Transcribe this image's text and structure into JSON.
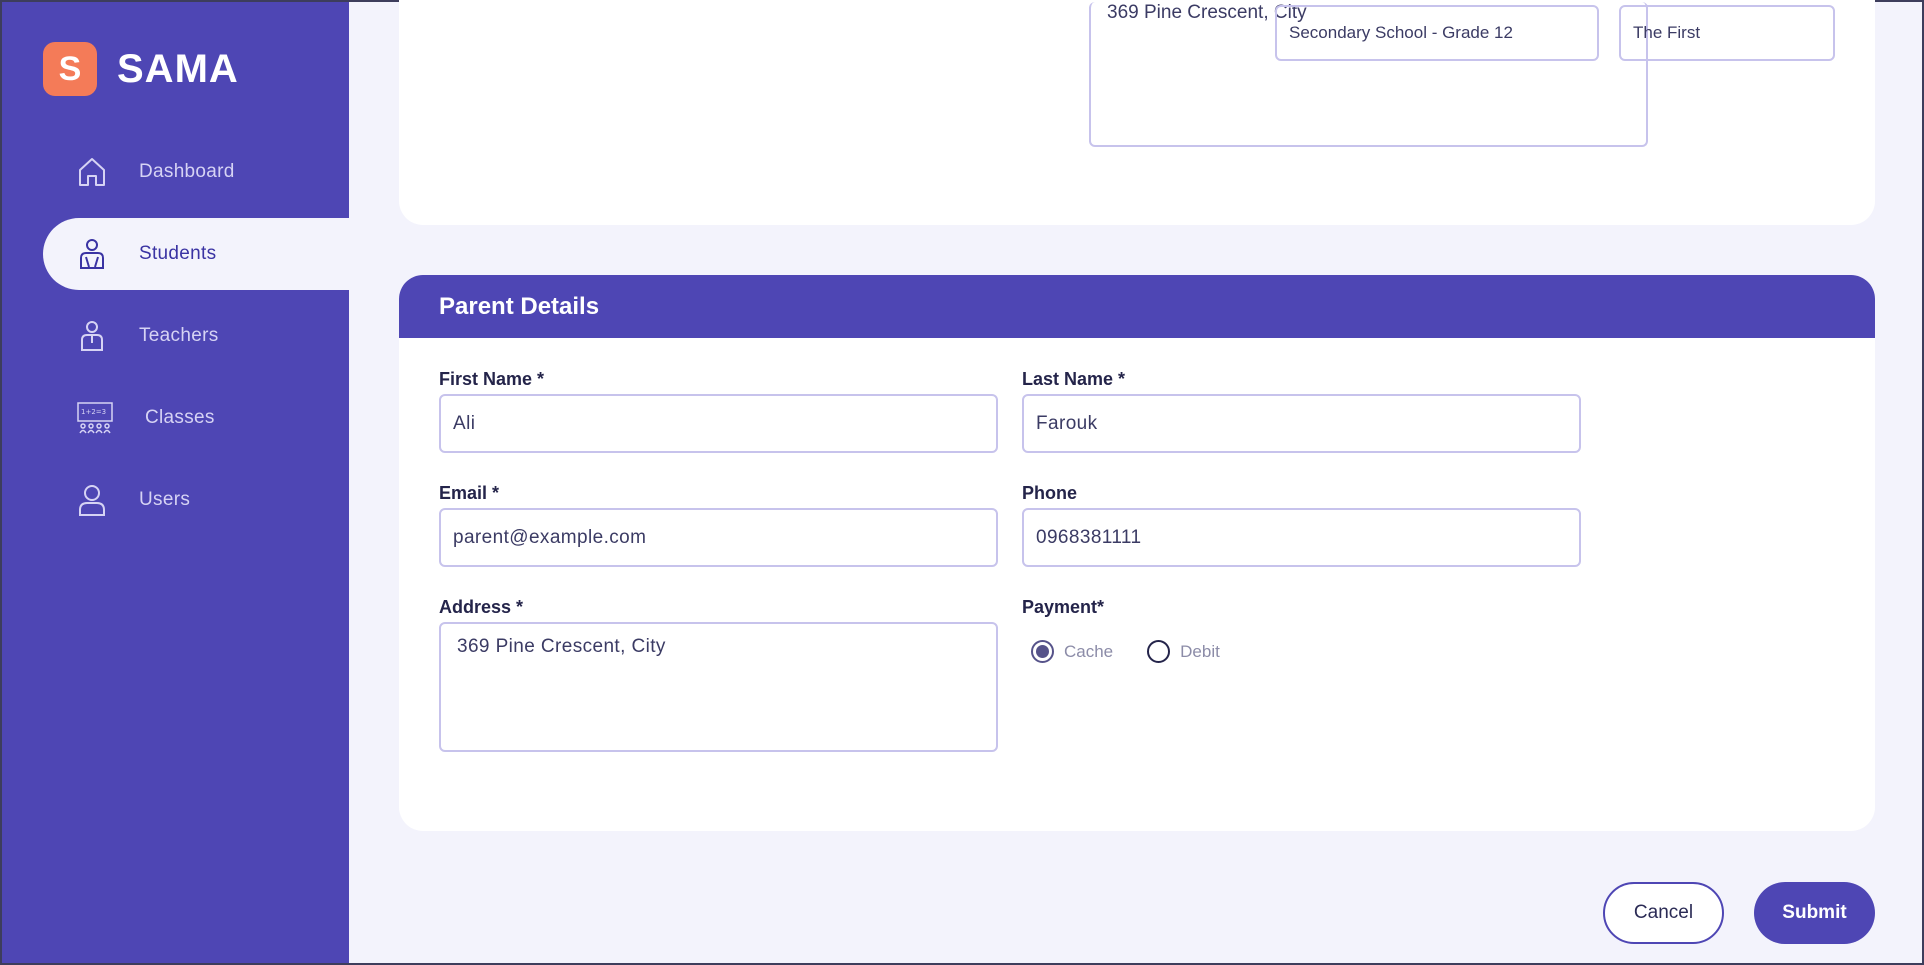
{
  "brand": {
    "logo_letter": "S",
    "name": "SAMA"
  },
  "sidebar": {
    "items": [
      {
        "label": "Dashboard",
        "icon": "home-icon"
      },
      {
        "label": "Students",
        "icon": "student-icon",
        "active": true
      },
      {
        "label": "Teachers",
        "icon": "teacher-icon"
      },
      {
        "label": "Classes",
        "icon": "classroom-icon"
      },
      {
        "label": "Users",
        "icon": "user-icon"
      }
    ]
  },
  "student_section": {
    "address_value": "369 Pine Crescent, City",
    "grade_value": "Secondary School - Grade 12",
    "section_value": "The First"
  },
  "parent_details": {
    "title": "Parent Details",
    "first_name": {
      "label": "First Name *",
      "value": "Ali"
    },
    "last_name": {
      "label": "Last Name *",
      "value": "Farouk"
    },
    "email": {
      "label": "Email *",
      "value": "parent@example.com"
    },
    "phone": {
      "label": "Phone",
      "value": "0968381111"
    },
    "address": {
      "label": "Address *",
      "value": "369 Pine Crescent, City"
    },
    "payment": {
      "label": "Payment*",
      "options": [
        "Cache",
        "Debit"
      ],
      "selected": "Cache"
    }
  },
  "actions": {
    "cancel": "Cancel",
    "submit": "Submit"
  },
  "colors": {
    "primary": "#4e46b4",
    "logo": "#f47b58",
    "background": "#f3f3fc",
    "input_border": "#c7c3ec"
  }
}
